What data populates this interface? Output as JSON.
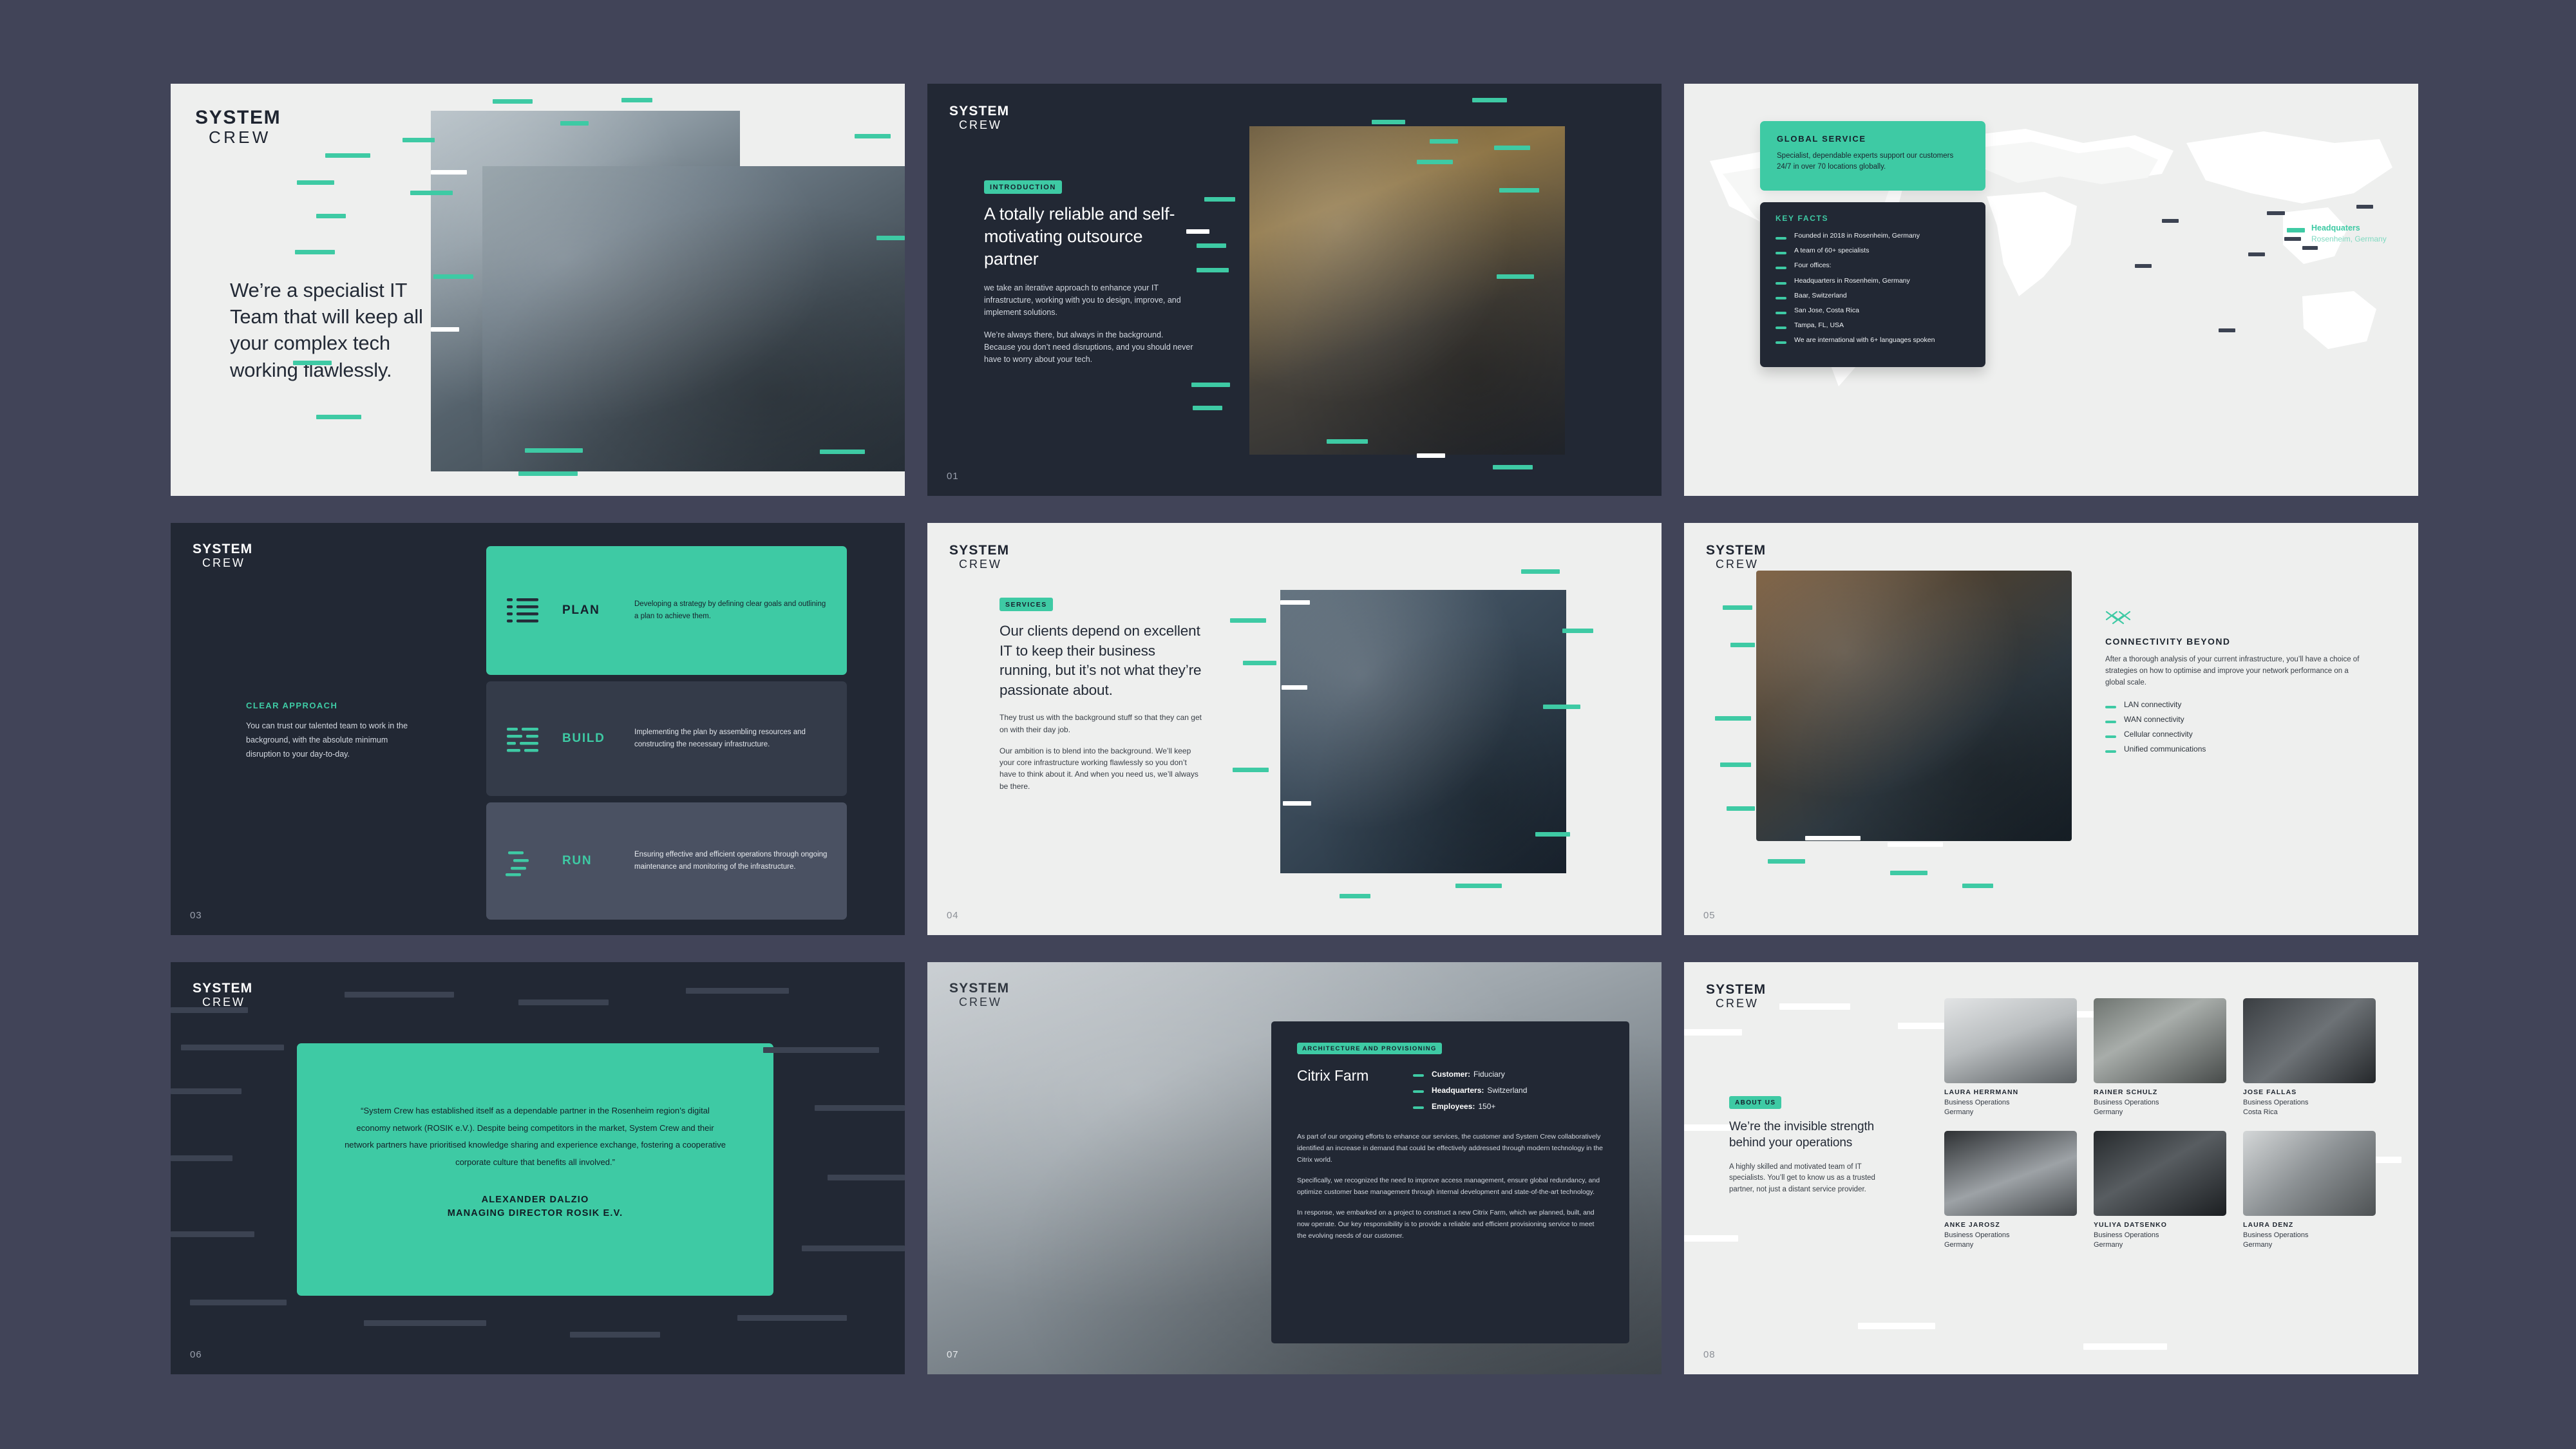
{
  "brand": {
    "logo_line1": "SYSTEM",
    "logo_line2": "CREW",
    "accent_teal": "#3ecaa4",
    "dark_navy": "#222834",
    "light_grey": "#eeefee",
    "page_bg": "#414458"
  },
  "slides": [
    {
      "id": "slide-title",
      "page": "",
      "theme": "light",
      "headline": "We’re a specialist IT Team that will keep all your complex tech working flawlessly."
    },
    {
      "id": "slide-introduction",
      "page": "01",
      "theme": "dark",
      "eyebrow": "INTRODUCTION",
      "headline": "A totally reliable and self-motivating outsource partner",
      "paragraphs": [
        "we take an iterative approach to enhance your IT infrastructure, working with you to design, improve, and implement solutions.",
        "We’re always there, but always in the background. Because you don’t need disruptions, and you should never have to worry about your tech."
      ]
    },
    {
      "id": "slide-global-service",
      "page": "",
      "theme": "light",
      "global_card": {
        "title": "GLOBAL SERVICE",
        "body": "Specialist, dependable experts support our customers 24/7 in over 70 locations globally."
      },
      "key_facts_card": {
        "title": "KEY FACTS",
        "items": [
          "Founded in 2018 in Rosenheim, Germany",
          "A team of 60+ specialists",
          "Four offices:",
          "Headquarters in Rosenheim, Germany",
          "Baar, Switzerland",
          "San Jose, Costa Rica",
          "Tampa, FL, USA",
          "We are international with 6+ languages spoken"
        ]
      },
      "map_label": {
        "title": "Headquaters",
        "subtitle": "Rosenheim, Germany"
      }
    },
    {
      "id": "slide-clear-approach",
      "page": "03",
      "theme": "dark",
      "eyebrow": "CLEAR APPROACH",
      "body": "You can trust our talented team to work in the background, with the absolute minimum disruption to your day-to-day.",
      "steps": [
        {
          "label": "PLAN",
          "text": "Developing a strategy by defining clear goals and outlining a plan to achieve them.",
          "icon": "list-bullets-icon"
        },
        {
          "label": "BUILD",
          "text": "Implementing the plan by assembling resources and constructing the necessary infrastructure.",
          "icon": "build-bars-icon"
        },
        {
          "label": "RUN",
          "text": "Ensuring effective and efficient operations through ongoing maintenance and monitoring of the infrastructure.",
          "icon": "run-stagger-icon"
        }
      ]
    },
    {
      "id": "slide-services",
      "page": "04",
      "theme": "light",
      "eyebrow": "SERVICES",
      "headline": "Our clients depend on excellent IT to keep their business running, but it’s not what they’re passionate about.",
      "paragraphs": [
        "They trust us with the background stuff so that they can get on with their day job.",
        "Our ambition is to blend into the background. We’ll keep your core infrastructure working flawlessly so you don’t have to think about it. And when you need us, we’ll always be there."
      ]
    },
    {
      "id": "slide-connectivity",
      "page": "05",
      "theme": "light",
      "title": "CONNECTIVITY BEYOND",
      "body": "After a thorough analysis of your current infrastructure, you’ll have a choice of strategies on how to optimise and improve your network performance on a global scale.",
      "items": [
        "LAN connectivity",
        "WAN connectivity",
        "Cellular connectivity",
        "Unified communications"
      ]
    },
    {
      "id": "slide-testimonial",
      "page": "06",
      "theme": "dark",
      "quote": "“System Crew has established itself as a dependable partner in the Rosenheim region’s digital economy network (ROSIK e.V.). Despite being competitors in the market, System Crew and their network partners have prioritised knowledge sharing and experience exchange, fostering a cooperative corporate culture that benefits all involved.”",
      "author_name": "ALEXANDER DALZIO",
      "author_title": "MANAGING DIRECTOR ROSIK E.V."
    },
    {
      "id": "slide-case-study",
      "page": "07",
      "theme": "dark",
      "eyebrow": "ARCHITECTURE AND PROVISIONING",
      "title": "Citrix Farm",
      "facts": [
        {
          "label": "Customer:",
          "value": "Fiduciary"
        },
        {
          "label": "Headquarters:",
          "value": "Switzerland"
        },
        {
          "label": "Employees:",
          "value": "150+"
        }
      ],
      "paragraphs": [
        "As part of our ongoing efforts to enhance our services, the customer and System Crew collaboratively identified an increase in demand that could be effectively addressed through modern technology in the Citrix world.",
        "Specifically, we recognized the need to improve access management, ensure global redundancy, and optimize customer base management through internal development and state-of-the-art technology.",
        "In response, we embarked on a project to construct a new Citrix Farm, which we planned, built, and now operate. Our key responsibility is to provide a reliable and efficient provisioning service to meet the evolving needs of our customer."
      ]
    },
    {
      "id": "slide-about-us",
      "page": "08",
      "theme": "light",
      "eyebrow": "ABOUT US",
      "headline": "We’re the invisible strength behind your operations",
      "body": "A highly skilled and motivated team of IT specialists. You’ll get to know us as a trusted partner, not just a distant service provider.",
      "team": [
        {
          "name": "LAURA HERRMANN",
          "role": "Business Operations",
          "location": "Germany"
        },
        {
          "name": "RAINER SCHULZ",
          "role": "Business Operations",
          "location": "Germany"
        },
        {
          "name": "JOSE FALLAS",
          "role": "Business Operations",
          "location": "Costa Rica"
        },
        {
          "name": "ANKE JAROSZ",
          "role": "Business Operations",
          "location": "Germany"
        },
        {
          "name": "YULIYA DATSENKO",
          "role": "Business Operations",
          "location": "Germany"
        },
        {
          "name": "LAURA DENZ",
          "role": "Business Operations",
          "location": "Germany"
        }
      ]
    }
  ]
}
